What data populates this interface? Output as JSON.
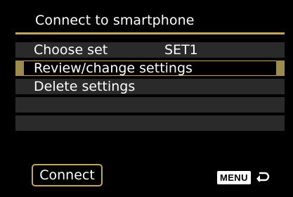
{
  "screen": {
    "title": "Connect to smartphone"
  },
  "menu": {
    "items": [
      {
        "label": "Choose set",
        "value": "SET1",
        "selected": false
      },
      {
        "label": "Review/change settings",
        "value": "",
        "selected": true
      },
      {
        "label": "Delete settings",
        "value": "",
        "selected": false
      },
      {
        "label": "",
        "value": "",
        "selected": false
      },
      {
        "label": "",
        "value": "",
        "selected": false
      }
    ]
  },
  "footer": {
    "connect_label": "Connect",
    "menu_label": "MENU",
    "back_icon": "return-arrow-icon"
  },
  "colors": {
    "accent": "#c0a565",
    "row_background": "#2a2a2a",
    "screen_background": "#000000"
  }
}
